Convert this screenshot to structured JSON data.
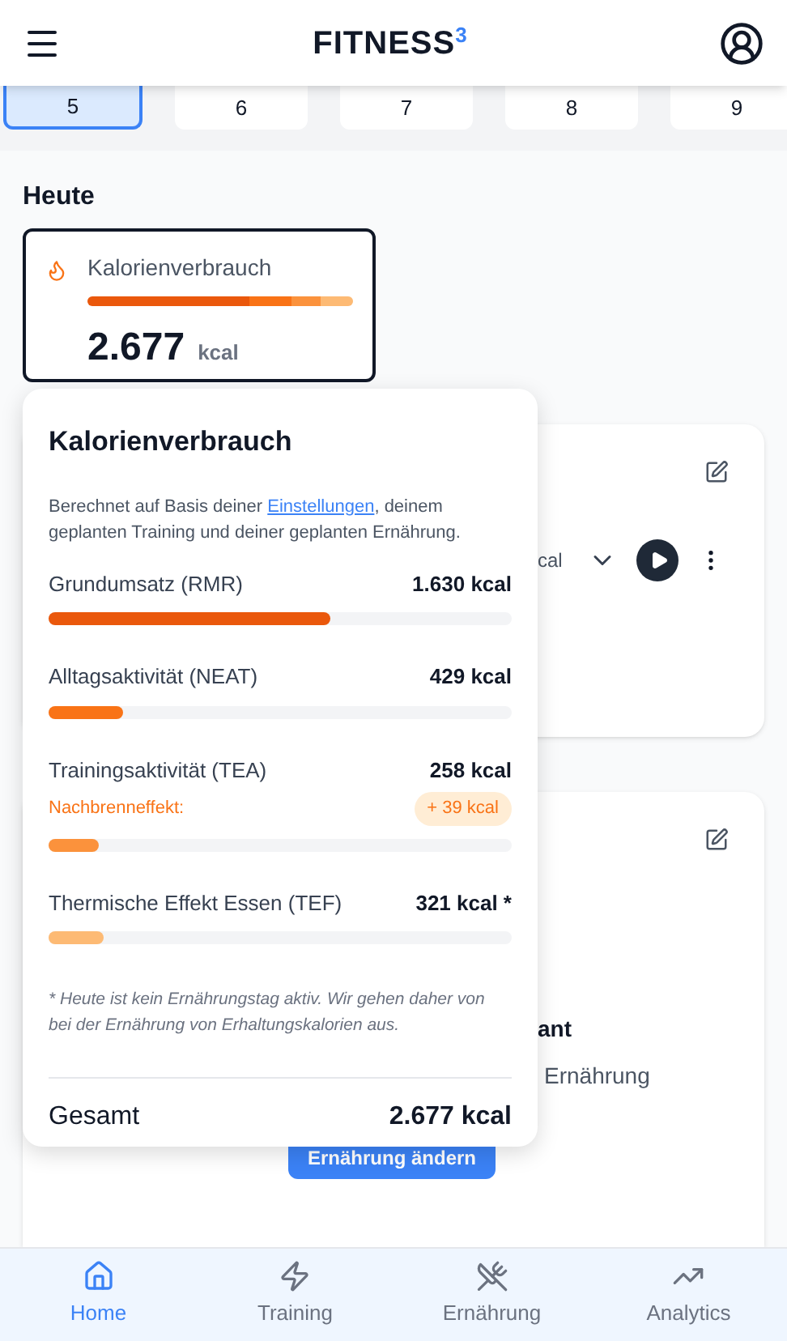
{
  "header": {
    "title": "FITNESS",
    "superscript": "3"
  },
  "days": [
    {
      "label": "5",
      "selected": true
    },
    {
      "label": "6",
      "selected": false
    },
    {
      "label": "7",
      "selected": false
    },
    {
      "label": "8",
      "selected": false
    },
    {
      "label": "9",
      "selected": false
    }
  ],
  "section_title": "Heute",
  "calorie_card": {
    "label": "Kalorienverbrauch",
    "value": "2.677",
    "unit": "kcal",
    "segments": [
      {
        "color": "#ea580c"
      },
      {
        "color": "#f97316"
      },
      {
        "color": "#fb923c"
      },
      {
        "color": "#fdba74"
      }
    ]
  },
  "background_card_1": {
    "text": "cal"
  },
  "background_card_2": {
    "heading": "ant",
    "text": "Ernährung",
    "button": "Ernährung ändern"
  },
  "popover": {
    "title": "Kalorienverbrauch",
    "intro_before": "Berechnet auf Basis deiner ",
    "intro_link": "Einstellungen",
    "intro_after": ", deinem geplanten Training und deiner geplanten Ernährung.",
    "items": [
      {
        "name": "Grundumsatz (RMR)",
        "value": "1.630 kcal",
        "level": 0.61,
        "color": "#ea580c"
      },
      {
        "name": "Alltagsaktivität (NEAT)",
        "value": "429 kcal",
        "level": 0.16,
        "color": "#f97316"
      },
      {
        "name": "Trainingsaktivität (TEA)",
        "value": "258 kcal",
        "level": 0.11,
        "color": "#fb923c",
        "extra_label": "Nachbrenneffekt:",
        "extra_value": "+ 39 kcal"
      },
      {
        "name": "Thermische Effekt Essen (TEF)",
        "value": "321 kcal *",
        "level": 0.12,
        "color": "#fdba74"
      }
    ],
    "note": "* Heute ist kein Ernährungstag aktiv. Wir gehen daher von bei der Ernährung von Erhaltungskalorien aus.",
    "total_label": "Gesamt",
    "total_value": "2.677 kcal"
  },
  "bottom_nav": [
    {
      "label": "Home",
      "selected": true
    },
    {
      "label": "Training",
      "selected": false
    },
    {
      "label": "Ernährung",
      "selected": false
    },
    {
      "label": "Analytics",
      "selected": false
    }
  ]
}
